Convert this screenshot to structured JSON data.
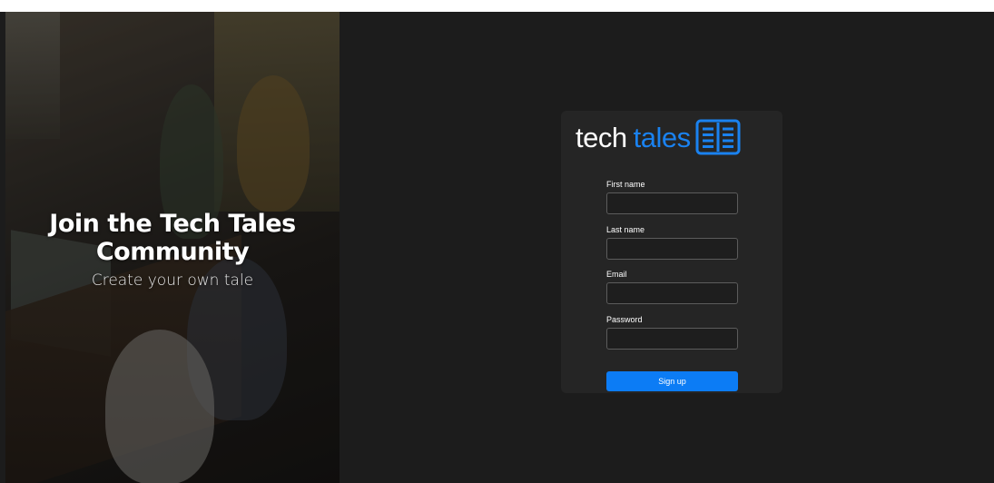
{
  "hero": {
    "title_line1": "Join the Tech Tales",
    "title_line2": "Community",
    "subtitle": "Create your own tale"
  },
  "logo": {
    "word1": "tech",
    "word2": "tales",
    "icon": "open-book-icon",
    "accent_color": "#1a82f0"
  },
  "form": {
    "fields": [
      {
        "label": "First name",
        "value": "",
        "placeholder": ""
      },
      {
        "label": "Last name",
        "value": "",
        "placeholder": ""
      },
      {
        "label": "Email",
        "value": "",
        "placeholder": ""
      },
      {
        "label": "Password",
        "value": "",
        "placeholder": ""
      }
    ],
    "submit_label": "Sign up",
    "submit_color": "#0c7cf5"
  }
}
